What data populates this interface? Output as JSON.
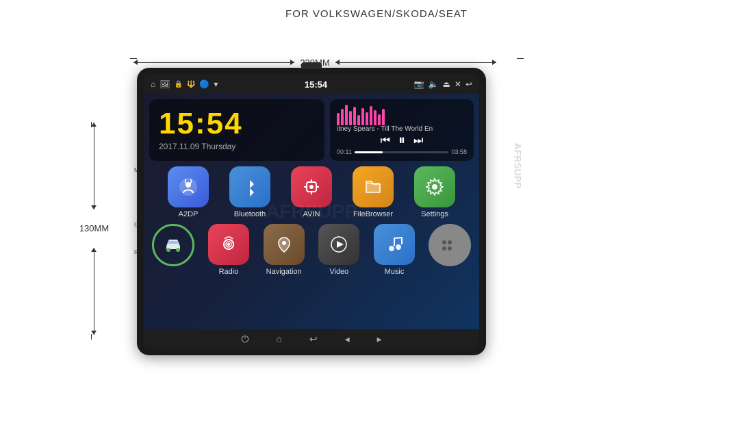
{
  "header": {
    "title": "FOR VOLKSWAGEN/SKODA/SEAT"
  },
  "dimensions": {
    "width_label": "220MM",
    "height_label": "130MM"
  },
  "device": {
    "side_labels": {
      "mic": "MIC",
      "gps": "GPS",
      "rst": "RST"
    }
  },
  "status_bar": {
    "time": "15:54",
    "icons_left": [
      "home",
      "image",
      "lock",
      "usb"
    ],
    "icons_right": [
      "camera",
      "volume",
      "eject",
      "close",
      "back"
    ]
  },
  "clock_widget": {
    "time": "15:54",
    "date": "2017.11.09 Thursday"
  },
  "music_widget": {
    "title": "itney Spears - Till The World En",
    "time_current": "00:11",
    "time_total": "03:58"
  },
  "apps_row1": [
    {
      "id": "a2dp",
      "label": "A2DP",
      "color_class": "app-a2dp",
      "icon": "🎧"
    },
    {
      "id": "bluetooth",
      "label": "Bluetooth",
      "color_class": "app-bluetooth",
      "icon": "🔵"
    },
    {
      "id": "avin",
      "label": "AVIN",
      "color_class": "app-avin",
      "icon": "🔌"
    },
    {
      "id": "filebrowser",
      "label": "FileBrowser",
      "color_class": "app-filebrowser",
      "icon": "📁"
    },
    {
      "id": "settings",
      "label": "Settings",
      "color_class": "app-settings",
      "icon": "⚙️"
    }
  ],
  "apps_row2": [
    {
      "id": "car",
      "label": "",
      "type": "car"
    },
    {
      "id": "radio",
      "label": "Radio",
      "color_class": "app-radio",
      "icon": "📡"
    },
    {
      "id": "navigation",
      "label": "Navigation",
      "color_class": "app-navigation",
      "icon": "📍"
    },
    {
      "id": "video",
      "label": "Video",
      "color_class": "app-video",
      "icon": "▶"
    },
    {
      "id": "music",
      "label": "Music",
      "color_class": "app-music",
      "icon": "🎵"
    },
    {
      "id": "more",
      "label": "",
      "type": "more"
    }
  ],
  "nav_bar": {
    "buttons": [
      "power",
      "home",
      "back",
      "volume-down",
      "volume-up"
    ]
  },
  "watermark": "AFRSUPP"
}
